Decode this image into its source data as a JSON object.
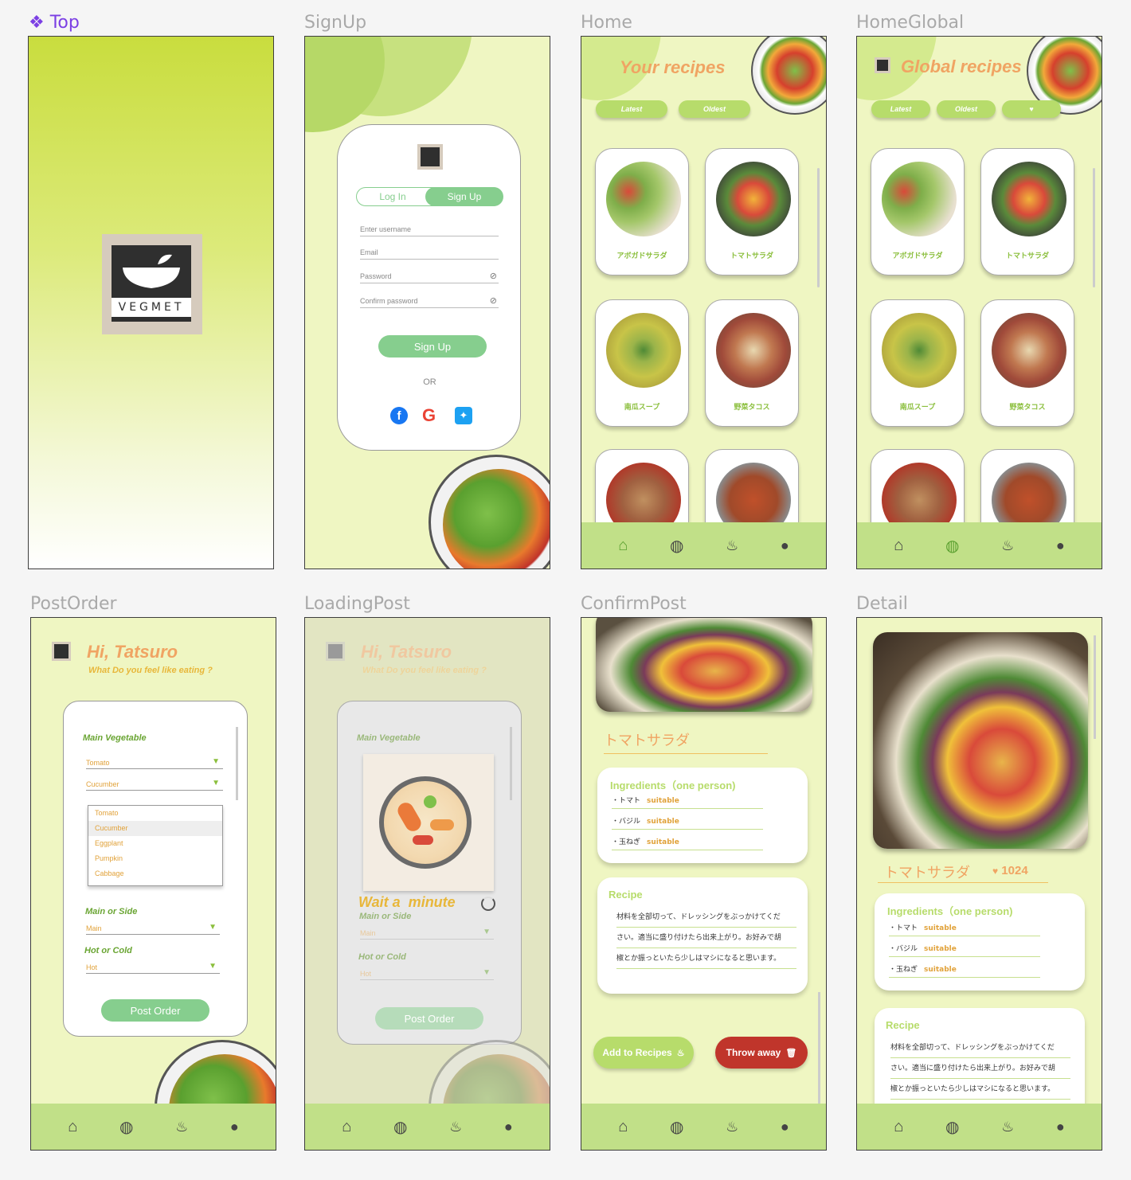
{
  "frame_labels": {
    "top": "Top",
    "signup": "SignUp",
    "home": "Home",
    "homeglobal": "HomeGlobal",
    "postorder": "PostOrder",
    "loadingpost": "LoadingPost",
    "confirmpost": "ConfirmPost",
    "detail": "Detail"
  },
  "logo_text": "VEGMET",
  "signup": {
    "tab_login": "Log In",
    "tab_signup": "Sign Up",
    "username": "Enter username",
    "email": "Email",
    "password": "Password",
    "confirm": "Confirm password",
    "button": "Sign Up",
    "or": "OR"
  },
  "home": {
    "title": "Your recipes",
    "filters": [
      "Latest",
      "Oldest"
    ]
  },
  "global": {
    "title": "Global recipes",
    "filters": [
      "Latest",
      "Oldest"
    ]
  },
  "recipes": [
    "アボガドサラダ",
    "トマトサラダ",
    "南瓜スープ",
    "野菜タコス"
  ],
  "order": {
    "greeting": "Hi, Tatsuro",
    "subtitle": "What Do you feel like eating ?",
    "main_veg_label": "Main Vegetable",
    "veg1": "Tomato",
    "veg2": "Cucumber",
    "options": [
      "Tomato",
      "Cucumber",
      "Eggplant",
      "Pumpkin",
      "Cabbage"
    ],
    "main_side_label": "Main or Side",
    "main_side": "Main",
    "hot_cold_label": "Hot or Cold",
    "hot_cold": "Hot",
    "button": "Post Order"
  },
  "loading": {
    "wait": "Wait a  minute"
  },
  "recipe_detail": {
    "name": "トマトサラダ",
    "likes": "1024",
    "ing_title": "Ingredients（one person)",
    "ingredients": [
      {
        "name": "・トマト",
        "tag": "suitable"
      },
      {
        "name": "・バジル",
        "tag": "suitable"
      },
      {
        "name": "・玉ねぎ",
        "tag": "suitable"
      }
    ],
    "recipe_title": "Recipe",
    "recipe_lines": [
      "材料を全部切って、ドレッシングをぶっかけてくだ",
      "さい。適当に盛り付けたら出来上がり。お好みで胡",
      "椒とか振っといたら少しはマシになると思います。"
    ],
    "add_button": "Add to Recipes",
    "throw_button": "Throw away"
  },
  "colors": {
    "bg": "#eff6c2",
    "nav": "#c1e088",
    "accent": "#b7dc6b",
    "orange": "#f0a463",
    "mint": "#86ce8e",
    "red": "#c0352b"
  }
}
